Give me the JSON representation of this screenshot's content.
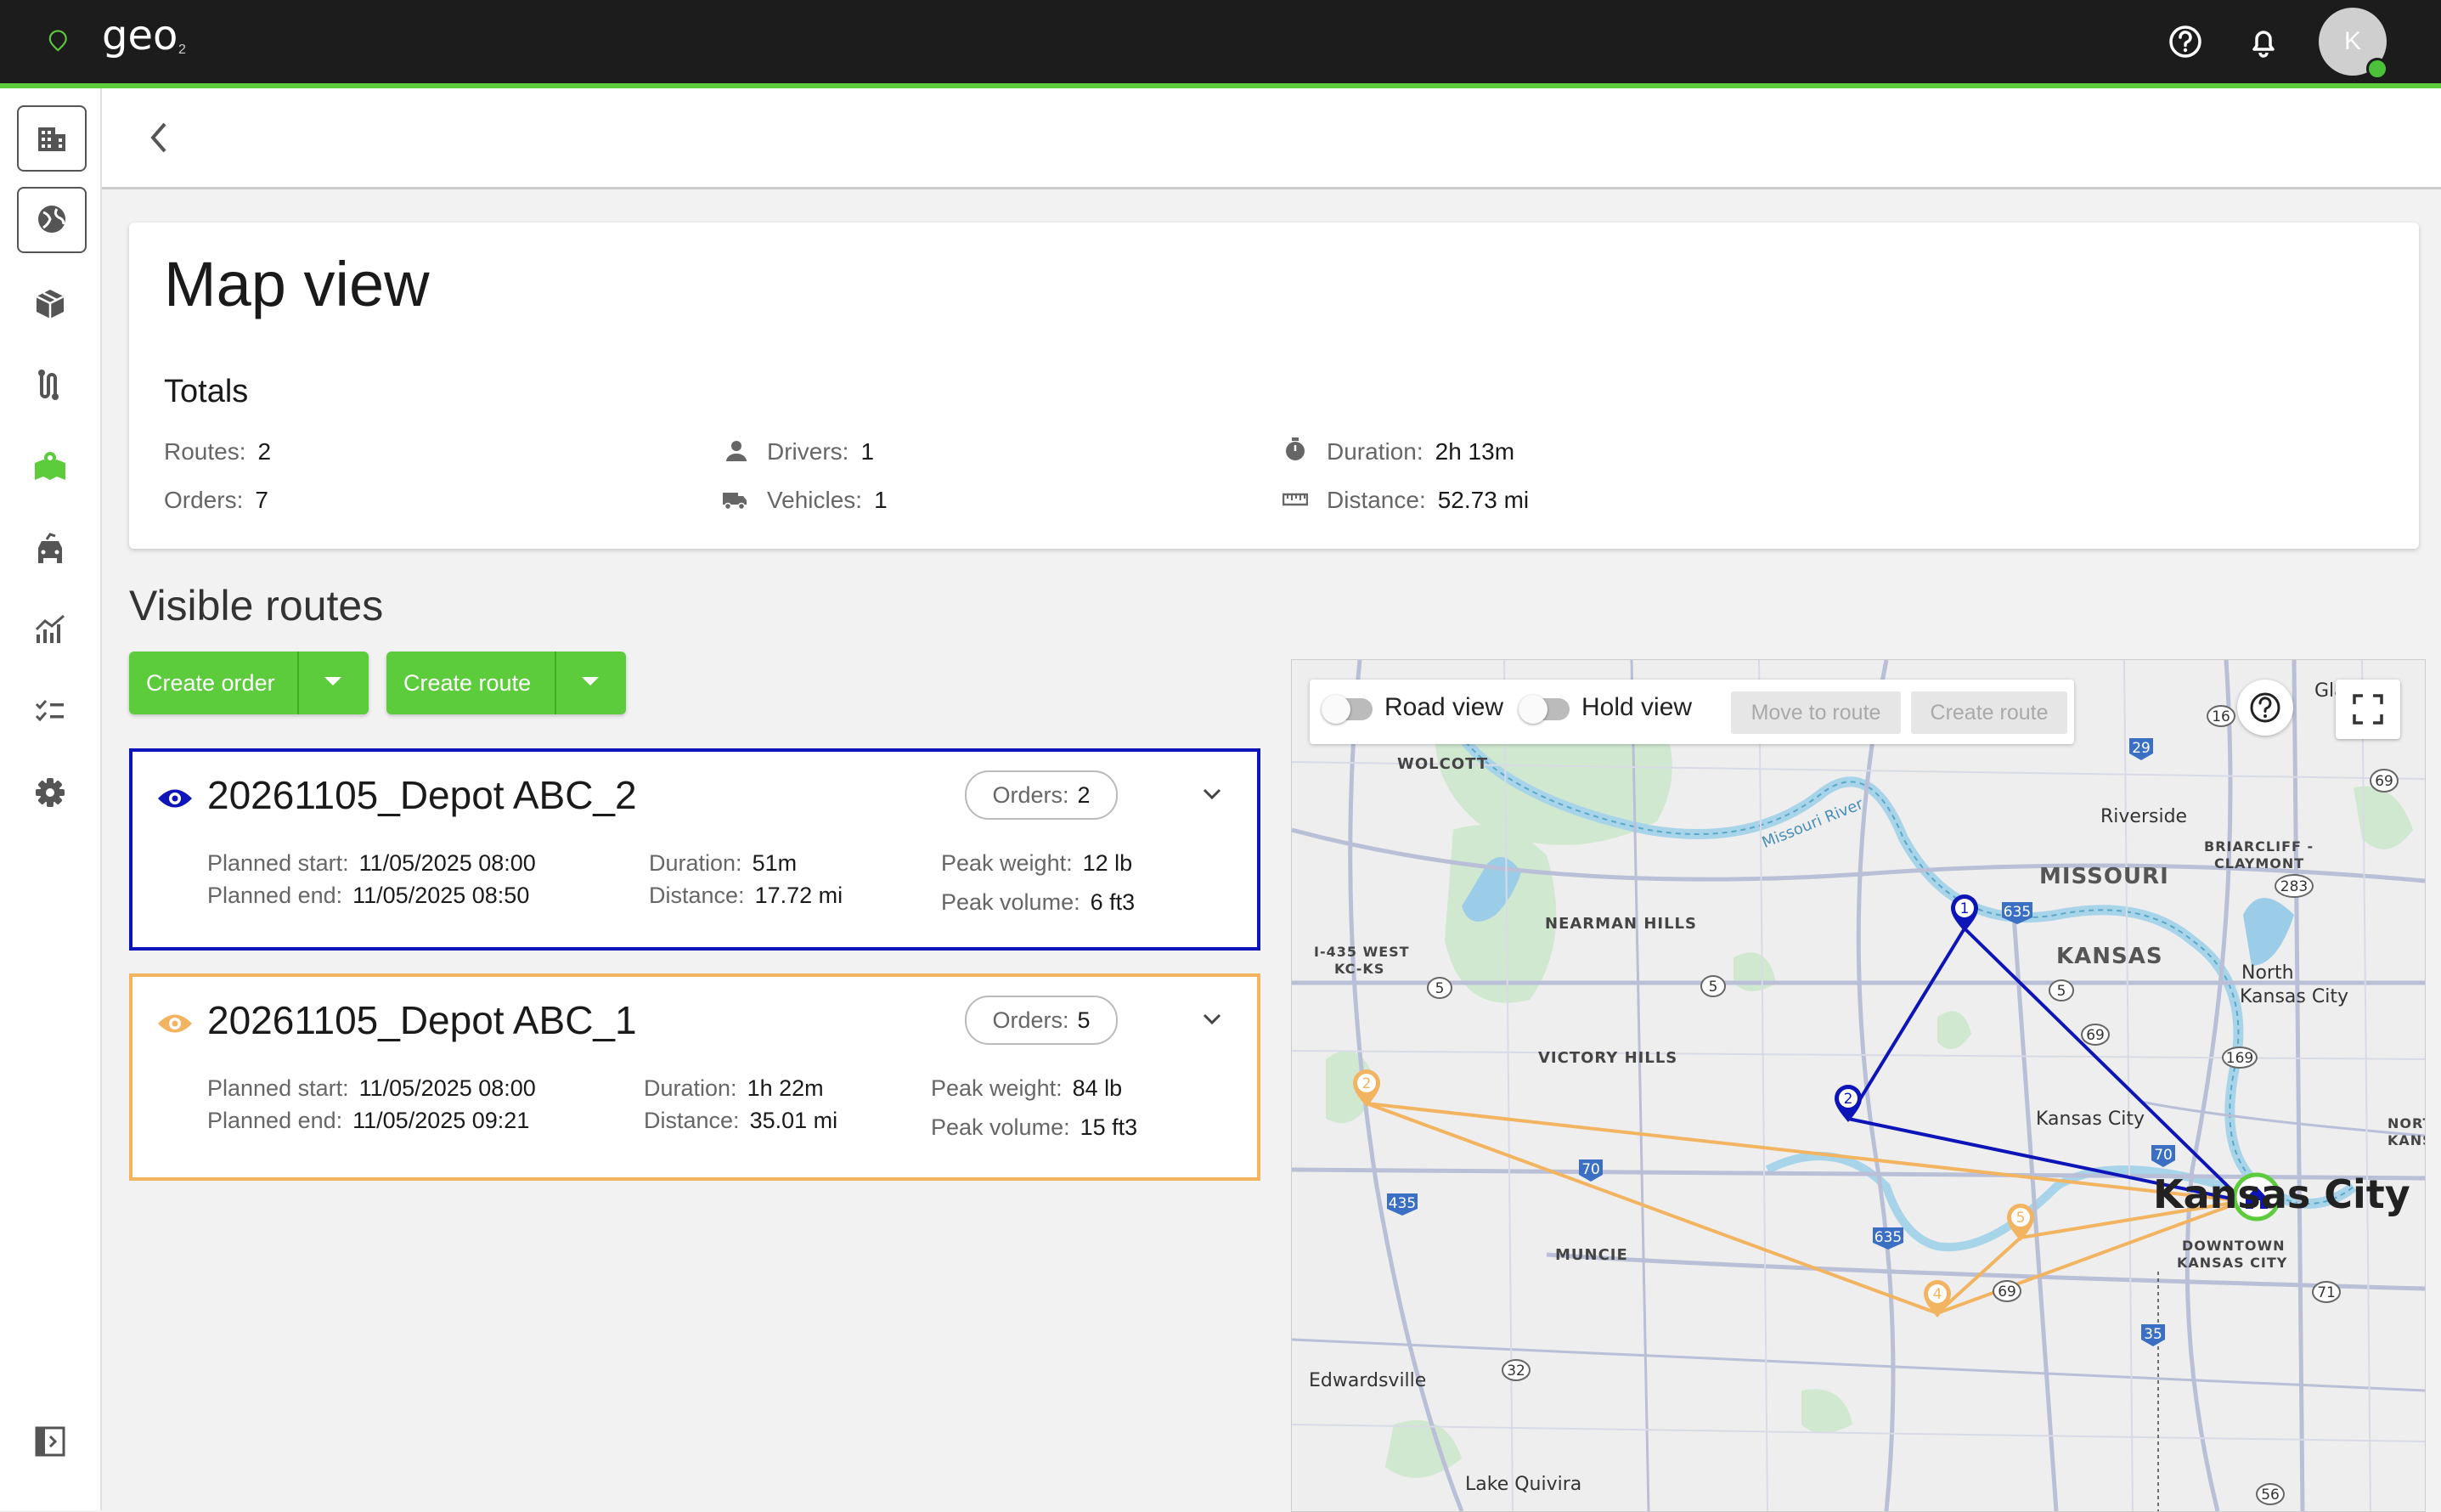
{
  "app": {
    "logo_text": "geo",
    "logo_sub": "2",
    "avatar_initial": "K",
    "accent_color": "#5ccb3c",
    "icons": [
      "help-circle-icon",
      "bell-icon"
    ]
  },
  "sidebar": {
    "items": [
      {
        "name": "buildings-icon",
        "active": false,
        "boxed": true
      },
      {
        "name": "globe-icon",
        "active": false,
        "boxed": true
      },
      {
        "name": "package-icon",
        "active": false
      },
      {
        "name": "route-icon",
        "active": false
      },
      {
        "name": "map-icon",
        "active": true
      },
      {
        "name": "vehicle-icon",
        "active": false
      },
      {
        "name": "analytics-icon",
        "active": false
      },
      {
        "name": "checklist-icon",
        "active": false
      },
      {
        "name": "settings-icon",
        "active": false
      }
    ],
    "collapse_icon": "sidebar-collapse-icon"
  },
  "page": {
    "title": "Map view",
    "totals_title": "Totals",
    "totals": {
      "routes_label": "Routes:",
      "routes_value": "2",
      "orders_label": "Orders:",
      "orders_value": "7",
      "drivers_label": "Drivers:",
      "drivers_value": "1",
      "vehicles_label": "Vehicles:",
      "vehicles_value": "1",
      "duration_label": "Duration:",
      "duration_value": "2h 13m",
      "distance_label": "Distance:",
      "distance_value": "52.73 mi"
    },
    "visible_routes_title": "Visible routes",
    "create_order_label": "Create order",
    "create_route_label": "Create route"
  },
  "routes": [
    {
      "name": "20261105_Depot ABC_2",
      "color": "#0d14b8",
      "orders_label": "Orders:",
      "orders_value": "2",
      "planned_start_label": "Planned start:",
      "planned_start": "11/05/2025 08:00",
      "planned_end_label": "Planned end:",
      "planned_end": "11/05/2025 08:50",
      "duration_label": "Duration:",
      "duration": "51m",
      "distance_label": "Distance:",
      "distance": "17.72 mi",
      "peak_weight_label": "Peak weight:",
      "peak_weight": "12 lb",
      "peak_volume_label": "Peak volume:",
      "peak_volume": "6 ft3"
    },
    {
      "name": "20261105_Depot ABC_1",
      "color": "#f2b460",
      "orders_label": "Orders:",
      "orders_value": "5",
      "planned_start_label": "Planned start:",
      "planned_start": "11/05/2025 08:00",
      "planned_end_label": "Planned end:",
      "planned_end": "11/05/2025 09:21",
      "duration_label": "Duration:",
      "duration": "1h 22m",
      "distance_label": "Distance:",
      "distance": "35.01 mi",
      "peak_weight_label": "Peak weight:",
      "peak_weight": "84 lb",
      "peak_volume_label": "Peak volume:",
      "peak_volume": "15 ft3"
    }
  ],
  "map": {
    "road_view_label": "Road view",
    "hold_view_label": "Hold view",
    "move_to_route_label": "Move to route",
    "create_route_label": "Create route",
    "places": {
      "wolcott": "WOLCOTT",
      "riverside": "Riverside",
      "briarcliff": "BRIARCLIFF -",
      "claymont": "CLAYMONT",
      "missouri": "MISSOURI",
      "kansas": "KANSAS",
      "missouri_river": "Missouri River",
      "nearman": "NEARMAN HILLS",
      "i435": "I-435 WEST",
      "kcks": "KC-KS",
      "north_kc_1": "North",
      "north_kc_2": "Kansas City",
      "victory": "VICTORY HILLS",
      "kansas_city_small": "Kansas City",
      "kansas_city_big": "Kansas City",
      "muncie": "MUNCIE",
      "downtown_1": "DOWNTOWN",
      "downtown_2": "KANSAS CITY",
      "edwardsville": "Edwardsville",
      "lake_quivira": "Lake Quivira",
      "nort": "NORT",
      "kans": "KANS",
      "gla": "Gla"
    },
    "highway_shields": [
      "29",
      "69",
      "283",
      "635",
      "5",
      "5",
      "5",
      "69",
      "169",
      "70",
      "70",
      "435",
      "635",
      "69",
      "71",
      "35",
      "32",
      "56",
      "16"
    ],
    "stops_blue": [
      "1",
      "2"
    ],
    "stops_orange": [
      "2",
      "4",
      "5"
    ]
  }
}
